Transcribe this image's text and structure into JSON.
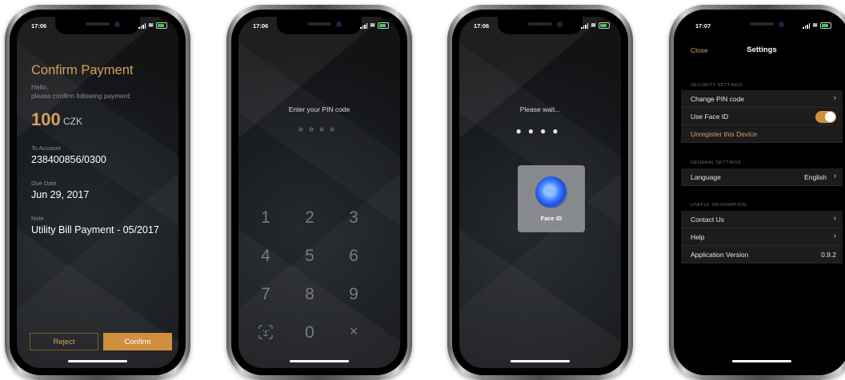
{
  "screen1": {
    "time": "17:06",
    "title": "Confirm Payment",
    "greeting": "Hello,",
    "subtitle": "please confirm following payment:",
    "amount": "100",
    "currency": "CZK",
    "account_label": "To Account",
    "account_value": "238400856/0300",
    "due_label": "Due Date",
    "due_value": "Jun 29, 2017",
    "note_label": "Note",
    "note_value": "Utility Bill Payment - 05/2017",
    "reject_label": "Reject",
    "confirm_label": "Confirm"
  },
  "screen2": {
    "time": "17:06",
    "prompt": "Enter your PIN code",
    "pin_dots": "○○○○",
    "keys": [
      "1",
      "2",
      "3",
      "4",
      "5",
      "6",
      "7",
      "8",
      "9",
      "0"
    ],
    "delete_glyph": "×"
  },
  "screen3": {
    "time": "17:06",
    "prompt": "Please wait...",
    "pin_dots": "●●●●",
    "faceid_label": "Face ID"
  },
  "screen4": {
    "time": "17:07",
    "close_label": "Close",
    "title": "Settings",
    "security_header": "SECURITY SETTINGS",
    "change_pin": "Change PIN code",
    "use_face_id": "Use Face ID",
    "use_face_id_enabled": true,
    "unregister": "Unregister this Device",
    "general_header": "GENERAL SETTINGS",
    "language_label": "Language",
    "language_value": "English",
    "useful_header": "USEFUL INFORMATION",
    "contact_us": "Contact Us",
    "help": "Help",
    "app_version_label": "Application Version",
    "app_version_value": "0.9.2"
  },
  "colors": {
    "accent": "#cf8f3f",
    "accent_text": "#d6a05c",
    "background": "#16181b",
    "battery": "#37d04a"
  },
  "icons": {
    "chevron": "chevron-right-icon",
    "face_id": "face-id-icon",
    "delete": "delete-icon"
  }
}
